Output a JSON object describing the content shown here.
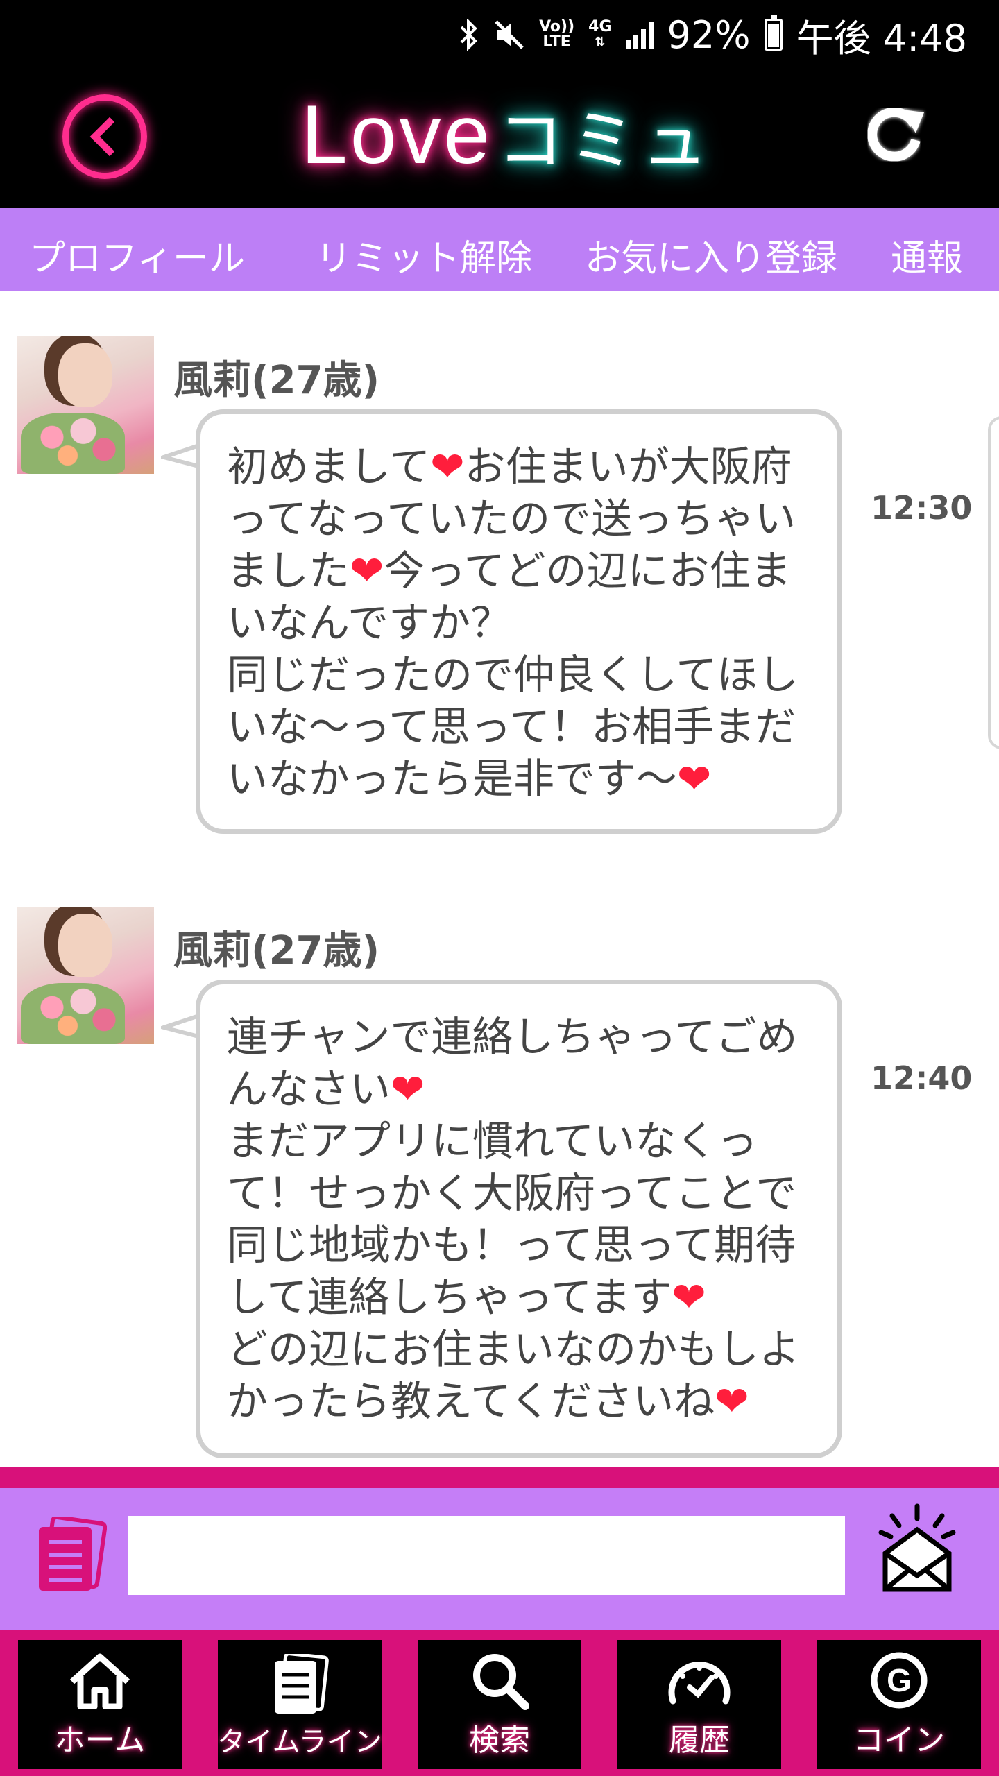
{
  "status_bar": {
    "network_lte_top": "Vo))",
    "network_lte_bottom": "LTE",
    "network_4g": "4G",
    "battery": "92%",
    "time": "午後 4:48"
  },
  "header": {
    "logo_love": "Love",
    "logo_commu": "コミュ",
    "colors": {
      "accent_pink": "#ff2d8e",
      "accent_teal": "#2ee6d6"
    }
  },
  "sub_nav": {
    "items": [
      "プロフィール",
      "リミット解除",
      "お気に入り登録",
      "通報"
    ],
    "background": "#bd7ff6"
  },
  "messages": [
    {
      "sender": "風莉(27歳)",
      "time": "12:30",
      "text": "初めまして❤お住まいが大阪府ってなっていたので送っちゃいました❤今ってどの辺にお住まいなんですか？\n同じだったので仲良くしてほしいな〜って思って！お相手まだいなかったら是非です〜❤"
    },
    {
      "sender": "風莉(27歳)",
      "time": "12:40",
      "text": "連チャンで連絡しちゃってごめんなさい❤\nまだアプリに慣れていなくって！せっかく大阪府ってことで同じ地域かも！って思って期待して連絡しちゃってます❤\nどの辺にお住まいなのかもしよかったら教えてくださいね❤"
    }
  ],
  "composer": {
    "input_value": "",
    "templates_icon": "templates-icon",
    "send_icon": "send-mail-icon"
  },
  "bottom_nav": {
    "items": [
      {
        "label": "ホーム",
        "icon": "home-icon"
      },
      {
        "label": "タイムライン",
        "icon": "timeline-icon"
      },
      {
        "label": "検索",
        "icon": "search-icon"
      },
      {
        "label": "履歴",
        "icon": "history-icon"
      },
      {
        "label": "コイン",
        "icon": "coin-icon"
      }
    ],
    "background": "#d8117a"
  }
}
